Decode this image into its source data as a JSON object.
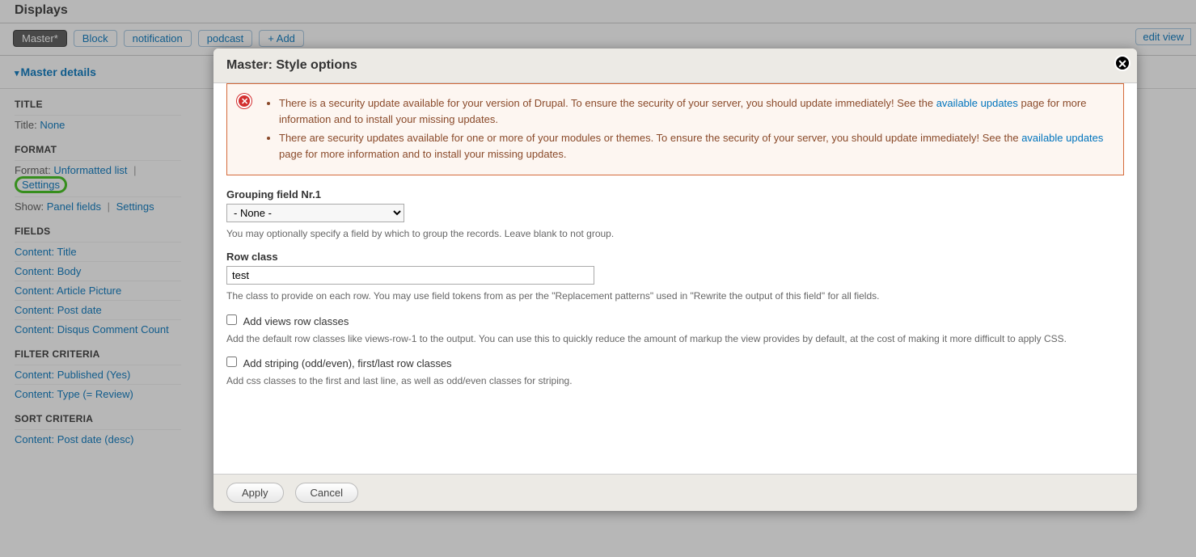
{
  "header": {
    "displays_heading": "Displays",
    "edit_view_label": "edit view"
  },
  "tabs": {
    "master": "Master*",
    "block": "Block",
    "notification": "notification",
    "podcast": "podcast",
    "add": "+ Add"
  },
  "details_toggle": "Master details",
  "sidebar": {
    "title": {
      "heading": "TITLE",
      "label": "Title:",
      "value": "None"
    },
    "format": {
      "heading": "FORMAT",
      "format_label": "Format:",
      "format_value": "Unformatted list",
      "format_settings": "Settings",
      "show_label": "Show:",
      "show_value": "Panel fields",
      "show_settings": "Settings"
    },
    "fields": {
      "heading": "FIELDS",
      "items": [
        "Content: Title",
        "Content: Body",
        "Content: Article Picture",
        "Content: Post date",
        "Content: Disqus Comment Count"
      ]
    },
    "filter": {
      "heading": "FILTER CRITERIA",
      "items": [
        "Content: Published (Yes)",
        "Content: Type (= Review)"
      ]
    },
    "sort": {
      "heading": "SORT CRITERIA",
      "items": [
        "Content: Post date (desc)"
      ]
    }
  },
  "modal": {
    "title": "Master: Style options",
    "alert": {
      "item1_a": "There is a security update available for your version of Drupal. To ensure the security of your server, you should update immediately! See the ",
      "item1_link": "available updates",
      "item1_b": " page for more information and to install your missing updates.",
      "item2_a": "There are security updates available for one or more of your modules or themes. To ensure the security of your server, you should update immediately! See the ",
      "item2_link": "available updates",
      "item2_b": " page for more information and to install your missing updates."
    },
    "grouping": {
      "label": "Grouping field Nr.1",
      "value": "- None -",
      "help": "You may optionally specify a field by which to group the records. Leave blank to not group."
    },
    "rowclass": {
      "label": "Row class",
      "value": "test",
      "help": "The class to provide on each row. You may use field tokens from as per the \"Replacement patterns\" used in \"Rewrite the output of this field\" for all fields."
    },
    "addrows": {
      "label": "Add views row classes",
      "help": "Add the default row classes like views-row-1 to the output. You can use this to quickly reduce the amount of markup the view provides by default, at the cost of making it more difficult to apply CSS."
    },
    "striping": {
      "label": "Add striping (odd/even), first/last row classes",
      "help": "Add css classes to the first and last line, as well as odd/even classes for striping."
    },
    "footer": {
      "apply": "Apply",
      "cancel": "Cancel"
    }
  }
}
